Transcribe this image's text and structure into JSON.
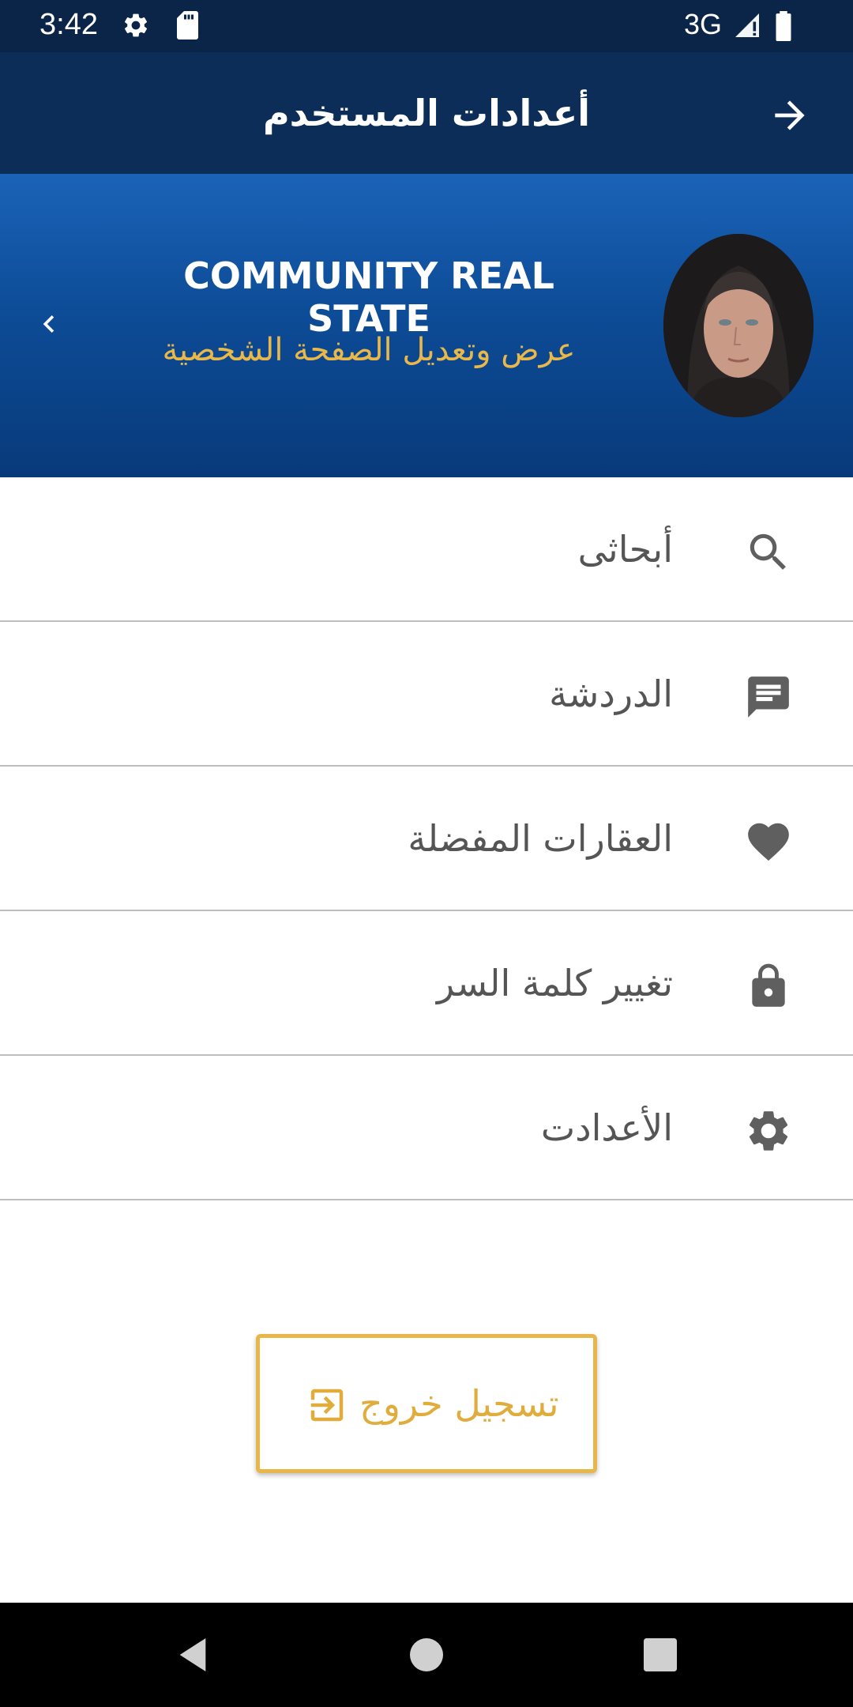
{
  "status_bar": {
    "time": "3:42",
    "network": "3G",
    "icons": [
      "gear-icon",
      "sd-card-icon",
      "signal-icon",
      "battery-icon"
    ]
  },
  "app_bar": {
    "title": "أعدادات المستخدم",
    "back_icon": "arrow-right-icon"
  },
  "profile": {
    "name": "COMMUNITY REAL STATE",
    "subtitle": "عرض وتعديل الصفحة الشخصية",
    "chevron_icon": "chevron-left-icon"
  },
  "menu": {
    "items": [
      {
        "label": "أبحاثى",
        "icon": "search-icon"
      },
      {
        "label": "الدردشة",
        "icon": "chat-icon"
      },
      {
        "label": "العقارات المفضلة",
        "icon": "heart-icon"
      },
      {
        "label": "تغيير كلمة السر",
        "icon": "lock-icon"
      },
      {
        "label": "الأعدادت",
        "icon": "settings-icon"
      }
    ]
  },
  "logout": {
    "label": "تسجيل خروج",
    "icon": "logout-icon"
  },
  "colors": {
    "status_bar": "#0a2548",
    "app_bar": "#0c2d57",
    "header_gradient_top": "#1b63b8",
    "header_gradient_bottom": "#083a7a",
    "accent_gold": "#e8b74a",
    "menu_text": "#555555",
    "divider": "#bdbdbd"
  }
}
